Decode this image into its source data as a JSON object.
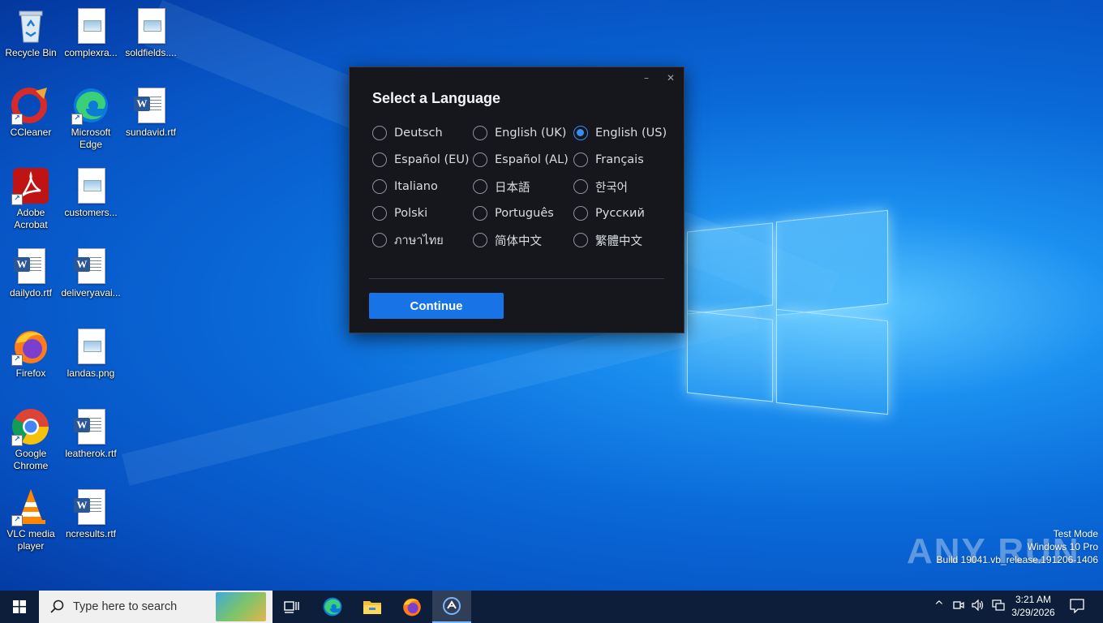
{
  "desktop": {
    "icons": [
      {
        "label": "Recycle Bin"
      },
      {
        "label": "complexra..."
      },
      {
        "label": "soldfields...."
      },
      {
        "label": "CCleaner"
      },
      {
        "label": "Microsoft Edge"
      },
      {
        "label": "sundavid.rtf"
      },
      {
        "label": "Adobe Acrobat"
      },
      {
        "label": "customers..."
      },
      {
        "label": "dailydo.rtf"
      },
      {
        "label": "deliveryavai..."
      },
      {
        "label": "Firefox"
      },
      {
        "label": "landas.png"
      },
      {
        "label": "Google Chrome"
      },
      {
        "label": "leatherok.rtf"
      },
      {
        "label": "VLC media player"
      },
      {
        "label": "ncresults.rtf"
      }
    ]
  },
  "dialog": {
    "title": "Select a Language",
    "minimize_glyph": "–",
    "close_glyph": "✕",
    "languages": [
      {
        "label": "Deutsch",
        "selected": false
      },
      {
        "label": "English (UK)",
        "selected": false
      },
      {
        "label": "English (US)",
        "selected": true
      },
      {
        "label": "Español (EU)",
        "selected": false
      },
      {
        "label": "Español (AL)",
        "selected": false
      },
      {
        "label": "Français",
        "selected": false
      },
      {
        "label": "Italiano",
        "selected": false
      },
      {
        "label": "日本語",
        "selected": false
      },
      {
        "label": "한국어",
        "selected": false
      },
      {
        "label": "Polski",
        "selected": false
      },
      {
        "label": "Português",
        "selected": false
      },
      {
        "label": "Русский",
        "selected": false
      },
      {
        "label": "ภาษาไทย",
        "selected": false
      },
      {
        "label": "简体中文",
        "selected": false
      },
      {
        "label": "繁體中文",
        "selected": false
      }
    ],
    "continue_label": "Continue",
    "accent_color": "#1874e6"
  },
  "watermark": {
    "brand": "ANY RUN",
    "line1": "Test Mode",
    "line2": "Windows 10 Pro",
    "line3": "Build 19041.vb_release.191206-1406"
  },
  "taskbar": {
    "search_placeholder": "Type here to search",
    "apps": [
      "task-view-icon",
      "edge-icon",
      "file-explorer-icon",
      "firefox-icon",
      "installer-app-icon"
    ],
    "clock_time": "3:21 AM",
    "clock_date": "3/29/2026"
  }
}
